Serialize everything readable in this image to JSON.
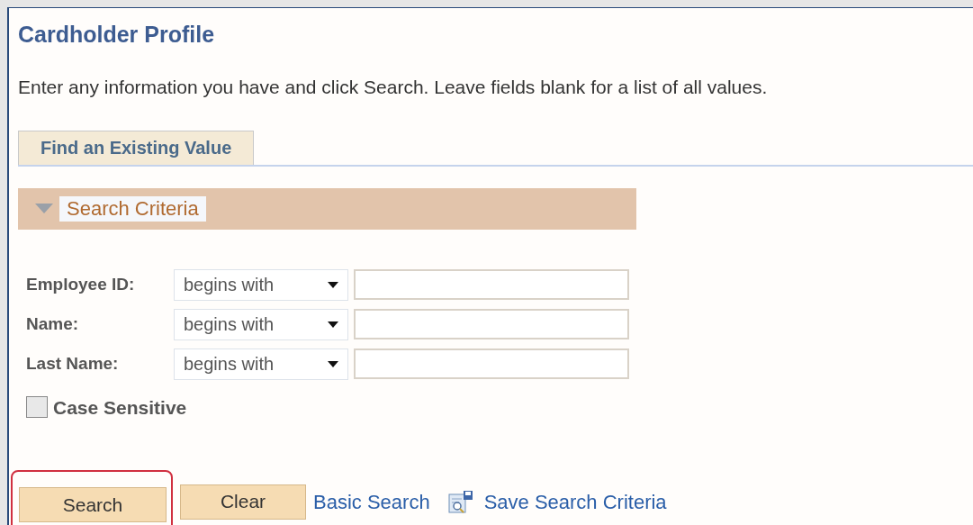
{
  "page": {
    "title": "Cardholder Profile",
    "instructions": "Enter any information you have and click Search. Leave fields blank for a list of all values."
  },
  "tabs": [
    {
      "label": "Find an Existing Value",
      "selected": true
    }
  ],
  "section": {
    "title": "Search Criteria",
    "expanded": true
  },
  "fields": [
    {
      "label": "Employee ID:",
      "operator": "begins with"
    },
    {
      "label": "Name:",
      "operator": "begins with"
    },
    {
      "label": "Last Name:",
      "operator": "begins with"
    }
  ],
  "case_sensitive": {
    "label": "Case Sensitive",
    "checked": false
  },
  "buttons": [
    {
      "label": "Search",
      "highlighted": true
    },
    {
      "label": "Clear",
      "highlighted": false
    }
  ],
  "links": [
    {
      "label": "Basic Search",
      "kind": "text"
    },
    {
      "label": "Save Search Criteria",
      "kind": "icon"
    }
  ]
}
